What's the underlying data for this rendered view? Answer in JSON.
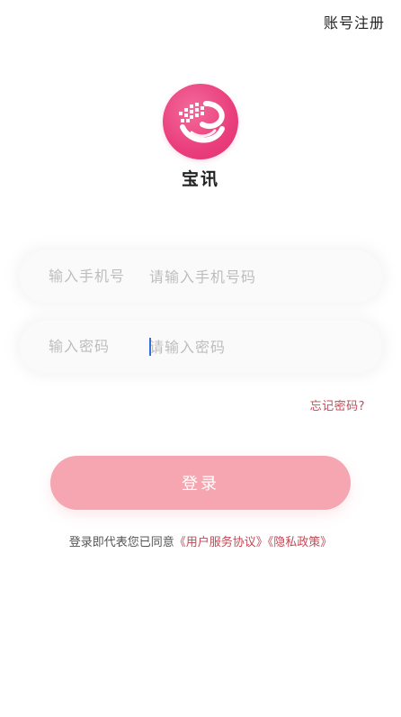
{
  "header": {
    "register_label": "账号注册"
  },
  "brand": {
    "app_name": "宝讯"
  },
  "form": {
    "phone": {
      "label": "输入手机号",
      "placeholder": "请输入手机号码",
      "value": ""
    },
    "password": {
      "label": "输入密码",
      "placeholder": "请输入密码",
      "value": ""
    },
    "forgot_label": "忘记密码?",
    "login_label": "登录"
  },
  "agreement": {
    "prefix": "登录即代表您已同意",
    "user_agreement": "《用户服务协议》",
    "privacy_policy": "《隐私政策》"
  },
  "colors": {
    "accent": "#ea3e7c",
    "button": "#f6a6b0",
    "link": "#c24a57"
  },
  "icons": {
    "logo": "baoxun-logo-icon"
  }
}
